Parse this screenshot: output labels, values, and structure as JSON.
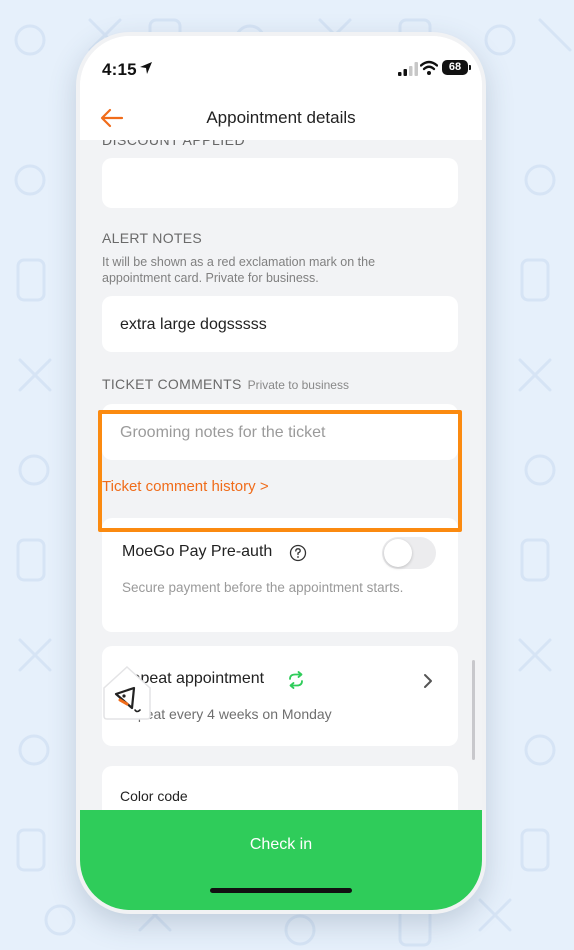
{
  "status_bar": {
    "time": "4:15",
    "battery": "68"
  },
  "nav": {
    "title": "Appointment details"
  },
  "discount": {
    "label": "DISCOUNT APPLIED",
    "value": ""
  },
  "alert_notes": {
    "label": "ALERT NOTES",
    "helper": "It will be shown as a red exclamation mark on the appointment card. Private for business.",
    "value": "extra large dogsssss"
  },
  "ticket_comments": {
    "label": "TICKET COMMENTS",
    "sublabel": "Private to business",
    "placeholder": "Grooming notes for the ticket",
    "history_link": "Ticket comment history >"
  },
  "preauth": {
    "title": "MoeGo Pay Pre-auth",
    "description": "Secure payment before the appointment starts.",
    "enabled": false
  },
  "repeat": {
    "title": "Repeat appointment",
    "description": "Repeat every 4 weeks on Monday"
  },
  "color_code": {
    "label": "Color code"
  },
  "footer": {
    "checkin_label": "Check in"
  },
  "colors": {
    "accent": "#f06c1a",
    "primary_green": "#2fcc5a",
    "highlight": "#fb8a10",
    "background": "#e6f0fb"
  },
  "icons": [
    "location-arrow-icon",
    "signal-icon",
    "wifi-icon",
    "back-arrow-icon",
    "help-icon",
    "repeat-icon",
    "chevron-right-icon",
    "mascot-icon"
  ]
}
